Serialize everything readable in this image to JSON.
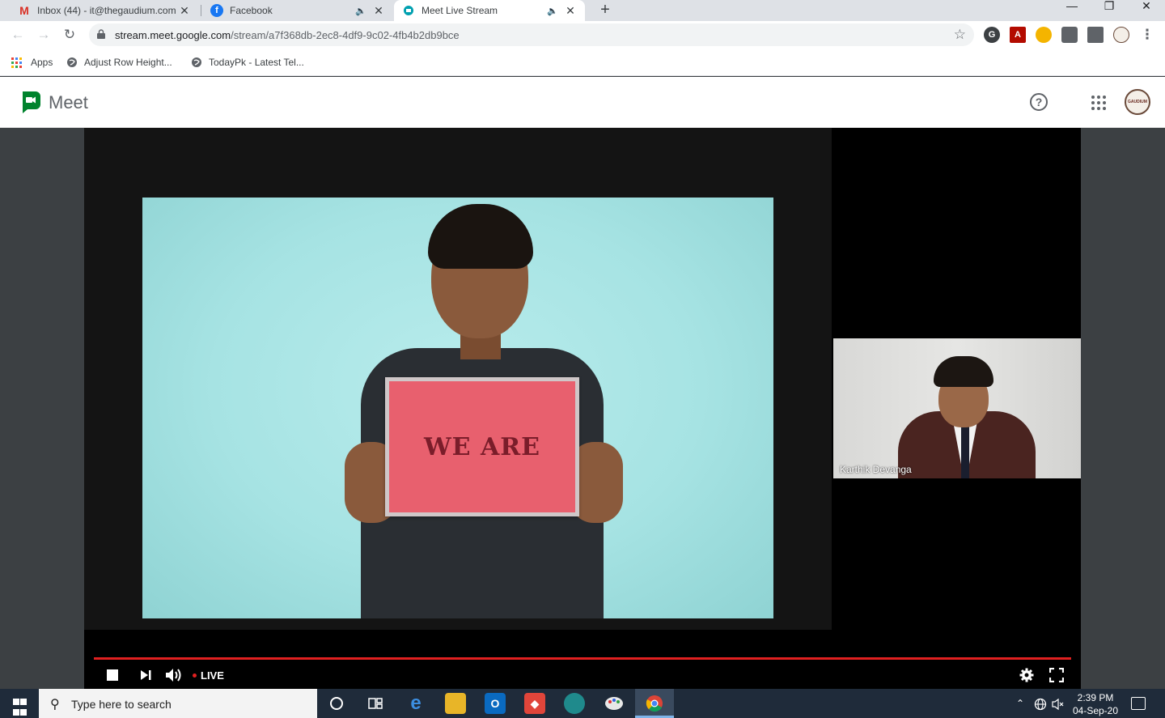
{
  "browser": {
    "tabs": [
      {
        "title": "Inbox (44) - it@thegaudium.com",
        "favicon": "gmail-icon"
      },
      {
        "title": "Facebook",
        "favicon": "facebook-icon"
      },
      {
        "title": "Meet Live Stream",
        "favicon": "meet-icon"
      }
    ],
    "new_tab": "+",
    "window_controls": {
      "minimize": "—",
      "restore": "❐",
      "close": "✕"
    },
    "url_host": "stream.meet.google.com",
    "url_path": "/stream/a7f368db-2ec8-4df9-9c02-4fb4b2db9bce",
    "bookmarks": [
      {
        "label": "Apps"
      },
      {
        "label": "Adjust Row Height..."
      },
      {
        "label": "TodayPk - Latest Tel..."
      }
    ]
  },
  "meet": {
    "title": "Meet",
    "avatar_text": "GAUDIUM"
  },
  "stream": {
    "sign_text": "WE ARE",
    "pip_name": "Karthik Devanga",
    "live_label": "LIVE",
    "progress_fraction": 1.0
  },
  "taskbar": {
    "search_placeholder": "Type here to search",
    "time": "2:39 PM",
    "date": "04-Sep-20"
  },
  "colors": {
    "progress": "#e02020",
    "meet_green": "#00832d",
    "taskbar": "#1f2b3a"
  }
}
